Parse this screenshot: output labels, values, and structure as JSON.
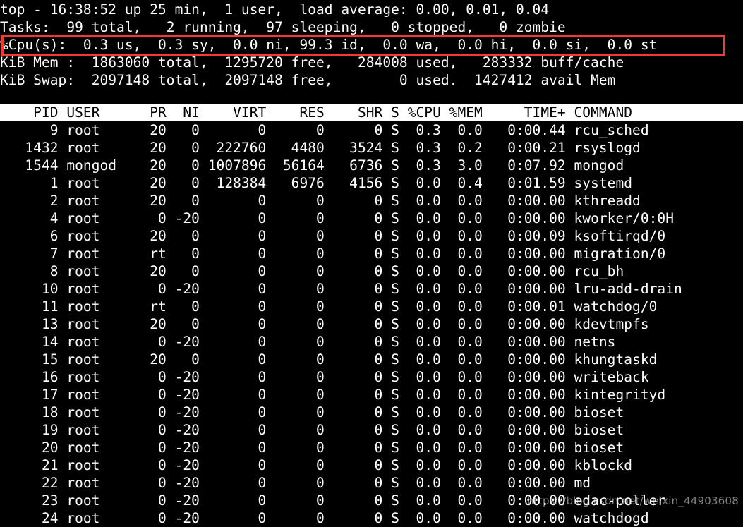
{
  "terminal": {
    "program": "top",
    "colors": {
      "background": "#000000",
      "foreground": "#ffffff",
      "header_bar_background": "#ffffff",
      "header_bar_foreground": "#000000",
      "annotation": "#f8372f"
    }
  },
  "summary": {
    "uptime_line": "top - 16:38:52 up 25 min,  1 user,  load average: 0.00, 0.01, 0.04",
    "uptime_parts": {
      "program": "top",
      "time": "16:38:52",
      "up": "25 min",
      "users": "1 user",
      "load_average": [
        "0.00",
        "0.01",
        "0.04"
      ]
    },
    "tasks_line": "Tasks:  99 total,   2 running,  97 sleeping,   0 stopped,   0 zombie",
    "tasks_parts": {
      "total": "99",
      "running": "2",
      "sleeping": "97",
      "stopped": "0",
      "zombie": "0"
    },
    "cpu_line": "%Cpu(s):  0.3 us,  0.3 sy,  0.0 ni, 99.3 id,  0.0 wa,  0.0 hi,  0.0 si,  0.0 st",
    "cpu_parts": {
      "us": "0.3",
      "sy": "0.3",
      "ni": "0.0",
      "id": "99.3",
      "wa": "0.0",
      "hi": "0.0",
      "si": "0.0",
      "st": "0.0"
    },
    "mem_line": "KiB Mem :  1863060 total,  1295720 free,   284008 used,   283332 buff/cache",
    "mem_parts": {
      "total": "1863060",
      "free": "1295720",
      "used": "284008",
      "buff_cache": "283332"
    },
    "swap_line": "KiB Swap:  2097148 total,  2097148 free,        0 used.  1427412 avail Mem",
    "swap_parts": {
      "total": "2097148",
      "free": "2097148",
      "used": "0",
      "avail_mem": "1427412"
    }
  },
  "table": {
    "header_line": "    PID USER      PR  NI    VIRT    RES    SHR S %CPU %MEM     TIME+ COMMAND",
    "columns": [
      "PID",
      "USER",
      "PR",
      "NI",
      "VIRT",
      "RES",
      "SHR",
      "S",
      "%CPU",
      "%MEM",
      "TIME+",
      "COMMAND"
    ],
    "rows": [
      {
        "line": "      9 root      20   0       0      0      0 S  0.3  0.0   0:00.44 rcu_sched",
        "PID": "9",
        "USER": "root",
        "PR": "20",
        "NI": "0",
        "VIRT": "0",
        "RES": "0",
        "SHR": "0",
        "S": "S",
        "CPU": "0.3",
        "MEM": "0.0",
        "TIME": "0:00.44",
        "COMMAND": "rcu_sched"
      },
      {
        "line": "   1432 root      20   0  222760   4480   3524 S  0.3  0.2   0:00.21 rsyslogd",
        "PID": "1432",
        "USER": "root",
        "PR": "20",
        "NI": "0",
        "VIRT": "222760",
        "RES": "4480",
        "SHR": "3524",
        "S": "S",
        "CPU": "0.3",
        "MEM": "0.2",
        "TIME": "0:00.21",
        "COMMAND": "rsyslogd"
      },
      {
        "line": "   1544 mongod    20   0 1007896  56164   6736 S  0.3  3.0   0:07.92 mongod",
        "PID": "1544",
        "USER": "mongod",
        "PR": "20",
        "NI": "0",
        "VIRT": "1007896",
        "RES": "56164",
        "SHR": "6736",
        "S": "S",
        "CPU": "0.3",
        "MEM": "3.0",
        "TIME": "0:07.92",
        "COMMAND": "mongod"
      },
      {
        "line": "      1 root      20   0  128384   6976   4156 S  0.0  0.4   0:01.59 systemd",
        "PID": "1",
        "USER": "root",
        "PR": "20",
        "NI": "0",
        "VIRT": "128384",
        "RES": "6976",
        "SHR": "4156",
        "S": "S",
        "CPU": "0.0",
        "MEM": "0.4",
        "TIME": "0:01.59",
        "COMMAND": "systemd"
      },
      {
        "line": "      2 root      20   0       0      0      0 S  0.0  0.0   0:00.00 kthreadd",
        "PID": "2",
        "USER": "root",
        "PR": "20",
        "NI": "0",
        "VIRT": "0",
        "RES": "0",
        "SHR": "0",
        "S": "S",
        "CPU": "0.0",
        "MEM": "0.0",
        "TIME": "0:00.00",
        "COMMAND": "kthreadd"
      },
      {
        "line": "      4 root       0 -20       0      0      0 S  0.0  0.0   0:00.00 kworker/0:0H",
        "PID": "4",
        "USER": "root",
        "PR": "0",
        "NI": "-20",
        "VIRT": "0",
        "RES": "0",
        "SHR": "0",
        "S": "S",
        "CPU": "0.0",
        "MEM": "0.0",
        "TIME": "0:00.00",
        "COMMAND": "kworker/0:0H"
      },
      {
        "line": "      6 root      20   0       0      0      0 S  0.0  0.0   0:00.09 ksoftirqd/0",
        "PID": "6",
        "USER": "root",
        "PR": "20",
        "NI": "0",
        "VIRT": "0",
        "RES": "0",
        "SHR": "0",
        "S": "S",
        "CPU": "0.0",
        "MEM": "0.0",
        "TIME": "0:00.09",
        "COMMAND": "ksoftirqd/0"
      },
      {
        "line": "      7 root      rt   0       0      0      0 S  0.0  0.0   0:00.00 migration/0",
        "PID": "7",
        "USER": "root",
        "PR": "rt",
        "NI": "0",
        "VIRT": "0",
        "RES": "0",
        "SHR": "0",
        "S": "S",
        "CPU": "0.0",
        "MEM": "0.0",
        "TIME": "0:00.00",
        "COMMAND": "migration/0"
      },
      {
        "line": "      8 root      20   0       0      0      0 S  0.0  0.0   0:00.00 rcu_bh",
        "PID": "8",
        "USER": "root",
        "PR": "20",
        "NI": "0",
        "VIRT": "0",
        "RES": "0",
        "SHR": "0",
        "S": "S",
        "CPU": "0.0",
        "MEM": "0.0",
        "TIME": "0:00.00",
        "COMMAND": "rcu_bh"
      },
      {
        "line": "     10 root       0 -20       0      0      0 S  0.0  0.0   0:00.00 lru-add-drain",
        "PID": "10",
        "USER": "root",
        "PR": "0",
        "NI": "-20",
        "VIRT": "0",
        "RES": "0",
        "SHR": "0",
        "S": "S",
        "CPU": "0.0",
        "MEM": "0.0",
        "TIME": "0:00.00",
        "COMMAND": "lru-add-drain"
      },
      {
        "line": "     11 root      rt   0       0      0      0 S  0.0  0.0   0:00.01 watchdog/0",
        "PID": "11",
        "USER": "root",
        "PR": "rt",
        "NI": "0",
        "VIRT": "0",
        "RES": "0",
        "SHR": "0",
        "S": "S",
        "CPU": "0.0",
        "MEM": "0.0",
        "TIME": "0:00.01",
        "COMMAND": "watchdog/0"
      },
      {
        "line": "     13 root      20   0       0      0      0 S  0.0  0.0   0:00.00 kdevtmpfs",
        "PID": "13",
        "USER": "root",
        "PR": "20",
        "NI": "0",
        "VIRT": "0",
        "RES": "0",
        "SHR": "0",
        "S": "S",
        "CPU": "0.0",
        "MEM": "0.0",
        "TIME": "0:00.00",
        "COMMAND": "kdevtmpfs"
      },
      {
        "line": "     14 root       0 -20       0      0      0 S  0.0  0.0   0:00.00 netns",
        "PID": "14",
        "USER": "root",
        "PR": "0",
        "NI": "-20",
        "VIRT": "0",
        "RES": "0",
        "SHR": "0",
        "S": "S",
        "CPU": "0.0",
        "MEM": "0.0",
        "TIME": "0:00.00",
        "COMMAND": "netns"
      },
      {
        "line": "     15 root      20   0       0      0      0 S  0.0  0.0   0:00.00 khungtaskd",
        "PID": "15",
        "USER": "root",
        "PR": "20",
        "NI": "0",
        "VIRT": "0",
        "RES": "0",
        "SHR": "0",
        "S": "S",
        "CPU": "0.0",
        "MEM": "0.0",
        "TIME": "0:00.00",
        "COMMAND": "khungtaskd"
      },
      {
        "line": "     16 root       0 -20       0      0      0 S  0.0  0.0   0:00.00 writeback",
        "PID": "16",
        "USER": "root",
        "PR": "0",
        "NI": "-20",
        "VIRT": "0",
        "RES": "0",
        "SHR": "0",
        "S": "S",
        "CPU": "0.0",
        "MEM": "0.0",
        "TIME": "0:00.00",
        "COMMAND": "writeback"
      },
      {
        "line": "     17 root       0 -20       0      0      0 S  0.0  0.0   0:00.00 kintegrityd",
        "PID": "17",
        "USER": "root",
        "PR": "0",
        "NI": "-20",
        "VIRT": "0",
        "RES": "0",
        "SHR": "0",
        "S": "S",
        "CPU": "0.0",
        "MEM": "0.0",
        "TIME": "0:00.00",
        "COMMAND": "kintegrityd"
      },
      {
        "line": "     18 root       0 -20       0      0      0 S  0.0  0.0   0:00.00 bioset",
        "PID": "18",
        "USER": "root",
        "PR": "0",
        "NI": "-20",
        "VIRT": "0",
        "RES": "0",
        "SHR": "0",
        "S": "S",
        "CPU": "0.0",
        "MEM": "0.0",
        "TIME": "0:00.00",
        "COMMAND": "bioset"
      },
      {
        "line": "     19 root       0 -20       0      0      0 S  0.0  0.0   0:00.00 bioset",
        "PID": "19",
        "USER": "root",
        "PR": "0",
        "NI": "-20",
        "VIRT": "0",
        "RES": "0",
        "SHR": "0",
        "S": "S",
        "CPU": "0.0",
        "MEM": "0.0",
        "TIME": "0:00.00",
        "COMMAND": "bioset"
      },
      {
        "line": "     20 root       0 -20       0      0      0 S  0.0  0.0   0:00.00 bioset",
        "PID": "20",
        "USER": "root",
        "PR": "0",
        "NI": "-20",
        "VIRT": "0",
        "RES": "0",
        "SHR": "0",
        "S": "S",
        "CPU": "0.0",
        "MEM": "0.0",
        "TIME": "0:00.00",
        "COMMAND": "bioset"
      },
      {
        "line": "     21 root       0 -20       0      0      0 S  0.0  0.0   0:00.00 kblockd",
        "PID": "21",
        "USER": "root",
        "PR": "0",
        "NI": "-20",
        "VIRT": "0",
        "RES": "0",
        "SHR": "0",
        "S": "S",
        "CPU": "0.0",
        "MEM": "0.0",
        "TIME": "0:00.00",
        "COMMAND": "kblockd"
      },
      {
        "line": "     22 root       0 -20       0      0      0 S  0.0  0.0   0:00.00 md",
        "PID": "22",
        "USER": "root",
        "PR": "0",
        "NI": "-20",
        "VIRT": "0",
        "RES": "0",
        "SHR": "0",
        "S": "S",
        "CPU": "0.0",
        "MEM": "0.0",
        "TIME": "0:00.00",
        "COMMAND": "md"
      },
      {
        "line": "     23 root       0 -20       0      0      0 S  0.0  0.0   0:00.00 edac-poller",
        "PID": "23",
        "USER": "root",
        "PR": "0",
        "NI": "-20",
        "VIRT": "0",
        "RES": "0",
        "SHR": "0",
        "S": "S",
        "CPU": "0.0",
        "MEM": "0.0",
        "TIME": "0:00.00",
        "COMMAND": "edac-poller"
      },
      {
        "line": "     24 root       0 -20       0      0      0 S  0.0  0.0   0:00.00 watchdogd",
        "PID": "24",
        "USER": "root",
        "PR": "0",
        "NI": "-20",
        "VIRT": "0",
        "RES": "0",
        "SHR": "0",
        "S": "S",
        "CPU": "0.0",
        "MEM": "0.0",
        "TIME": "0:00.00",
        "COMMAND": "watchdogd"
      }
    ]
  },
  "annotation": {
    "type": "rectangle-highlight",
    "target": "cpu_line",
    "color": "#f8372f"
  },
  "watermark": {
    "text": "https://blog.csdn.net/weixin_44903608"
  }
}
